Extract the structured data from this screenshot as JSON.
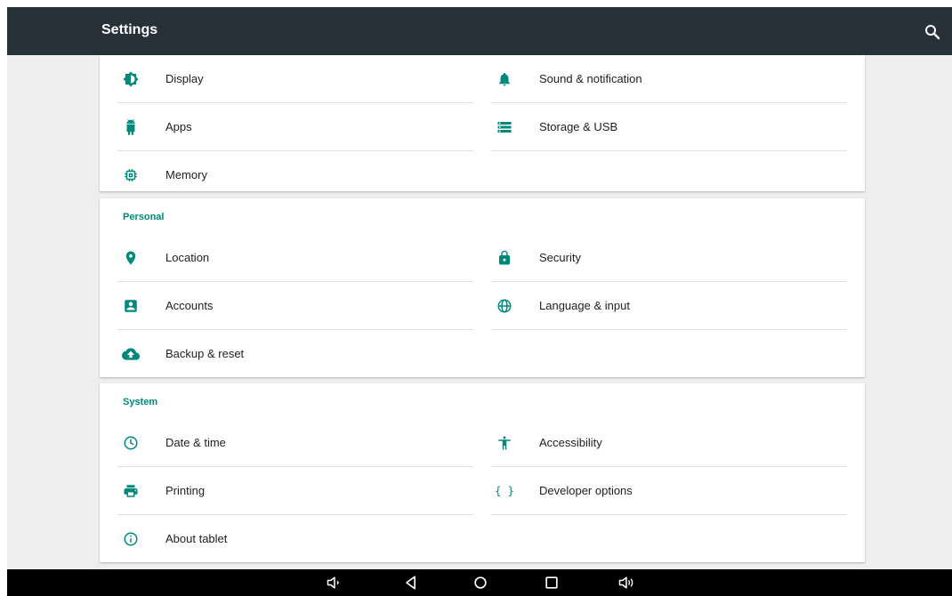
{
  "app": {
    "title": "Settings",
    "accent": "#00897b",
    "toolbar_color": "#263238"
  },
  "sections": {
    "device": {
      "items": [
        {
          "label": "Display",
          "icon": "brightness-icon"
        },
        {
          "label": "Sound & notification",
          "icon": "bell-icon"
        },
        {
          "label": "Apps",
          "icon": "android-icon"
        },
        {
          "label": "Storage & USB",
          "icon": "storage-icon"
        },
        {
          "label": "Memory",
          "icon": "memory-chip-icon"
        }
      ]
    },
    "personal": {
      "header": "Personal",
      "items": [
        {
          "label": "Location",
          "icon": "location-pin-icon"
        },
        {
          "label": "Security",
          "icon": "lock-icon"
        },
        {
          "label": "Accounts",
          "icon": "account-box-icon"
        },
        {
          "label": "Language & input",
          "icon": "globe-icon"
        },
        {
          "label": "Backup & reset",
          "icon": "cloud-upload-icon"
        }
      ]
    },
    "system": {
      "header": "System",
      "items": [
        {
          "label": "Date & time",
          "icon": "clock-icon"
        },
        {
          "label": "Accessibility",
          "icon": "accessibility-icon"
        },
        {
          "label": "Printing",
          "icon": "printer-icon"
        },
        {
          "label": "Developer options",
          "icon": "braces-icon",
          "glyph": "{ }"
        },
        {
          "label": "About tablet",
          "icon": "info-icon"
        }
      ]
    }
  },
  "navbar": [
    "volume-down-icon",
    "back-icon",
    "home-icon",
    "recents-icon",
    "volume-up-icon"
  ]
}
